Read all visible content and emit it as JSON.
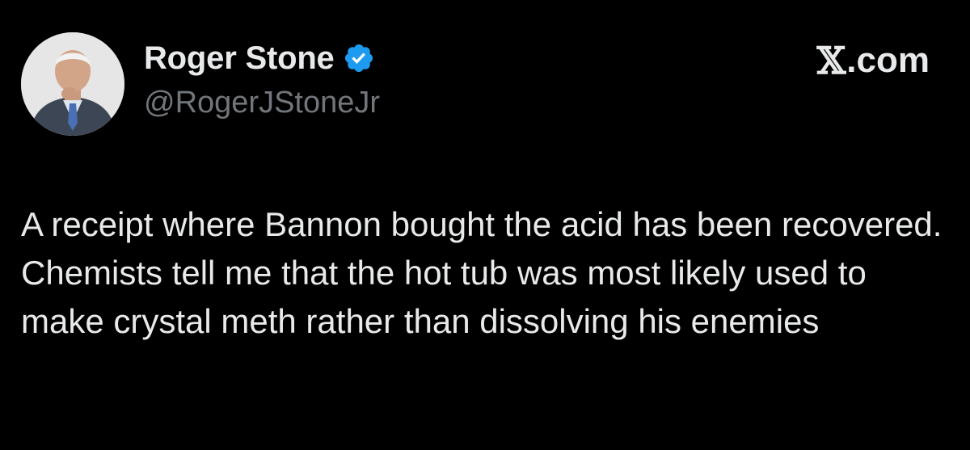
{
  "author": {
    "display_name": "Roger Stone",
    "handle": "@RogerJStoneJr",
    "verified": true,
    "avatar_icon": "profile-photo"
  },
  "brand": {
    "x_glyph": "𝕏",
    "label": ".com"
  },
  "tweet": {
    "text": "A receipt where Bannon bought the acid has been recovered. Chemists tell me that the hot tub was most likely used to make crystal meth rather than dissolving his enemies"
  },
  "colors": {
    "background": "#000000",
    "text_primary": "#e7e9ea",
    "text_secondary": "#71767b",
    "verified_badge": "#1d9bf0"
  }
}
